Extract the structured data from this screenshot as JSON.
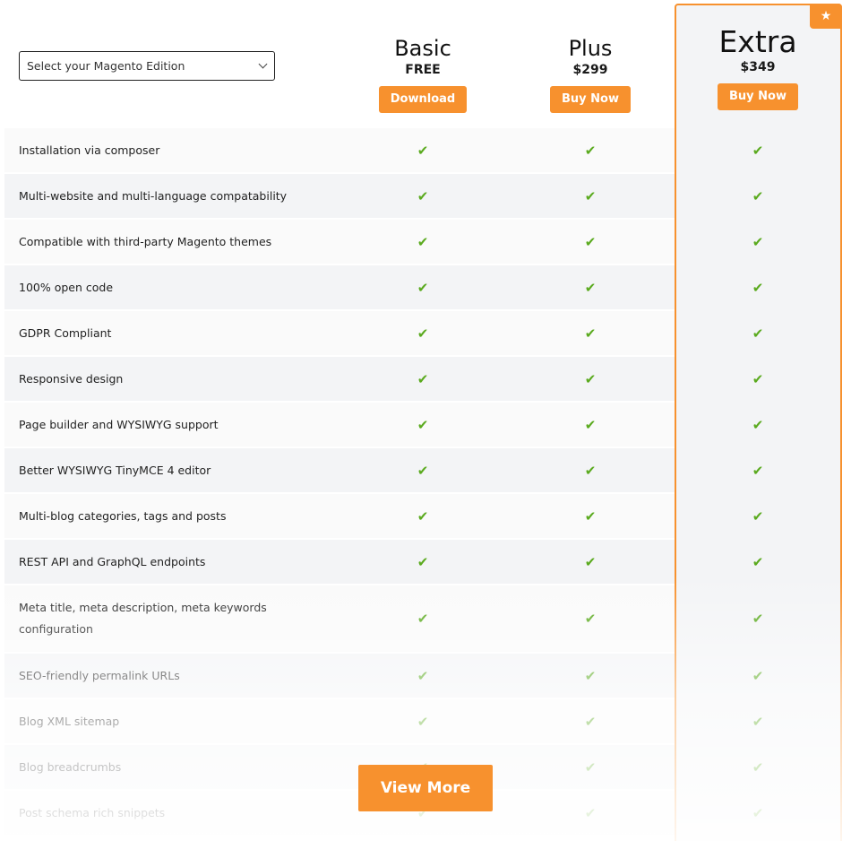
{
  "select": {
    "placeholder": "Select your Magento Edition"
  },
  "plans": [
    {
      "name": "Basic",
      "price": "FREE",
      "button": "Download"
    },
    {
      "name": "Plus",
      "price": "$299",
      "button": "Buy Now"
    },
    {
      "name": "Extra",
      "price": "$349",
      "button": "Buy Now",
      "featured": true,
      "badge_icon": "star-icon"
    }
  ],
  "features": [
    {
      "label": "Installation via composer",
      "basic": true,
      "plus": true,
      "extra": true
    },
    {
      "label": "Multi-website and multi-language compatability",
      "basic": true,
      "plus": true,
      "extra": true
    },
    {
      "label": "Compatible with third-party Magento themes",
      "basic": true,
      "plus": true,
      "extra": true
    },
    {
      "label": "100% open code",
      "basic": true,
      "plus": true,
      "extra": true
    },
    {
      "label": "GDPR Compliant",
      "basic": true,
      "plus": true,
      "extra": true
    },
    {
      "label": "Responsive design",
      "basic": true,
      "plus": true,
      "extra": true
    },
    {
      "label": "Page builder and WYSIWYG support",
      "basic": true,
      "plus": true,
      "extra": true
    },
    {
      "label": "Better WYSIWYG TinyMCE 4 editor",
      "basic": true,
      "plus": true,
      "extra": true
    },
    {
      "label": "Multi-blog categories, tags and posts",
      "basic": true,
      "plus": true,
      "extra": true
    },
    {
      "label": "REST API and GraphQL endpoints",
      "basic": true,
      "plus": true,
      "extra": true
    },
    {
      "label": "Meta title, meta description, meta keywords configuration",
      "basic": true,
      "plus": true,
      "extra": true
    },
    {
      "label": "SEO-friendly permalink URLs",
      "basic": true,
      "plus": true,
      "extra": true
    },
    {
      "label": "Blog XML sitemap",
      "basic": true,
      "plus": true,
      "extra": true
    },
    {
      "label": "Blog breadcrumbs",
      "basic": true,
      "plus": true,
      "extra": true
    },
    {
      "label": "Post schema rich snippets",
      "basic": true,
      "plus": true,
      "extra": true
    }
  ],
  "check_glyph": "✔",
  "star_glyph": "★",
  "view_more": "View More",
  "colors": {
    "accent": "#f7912e",
    "check": "#5aaa1e"
  }
}
